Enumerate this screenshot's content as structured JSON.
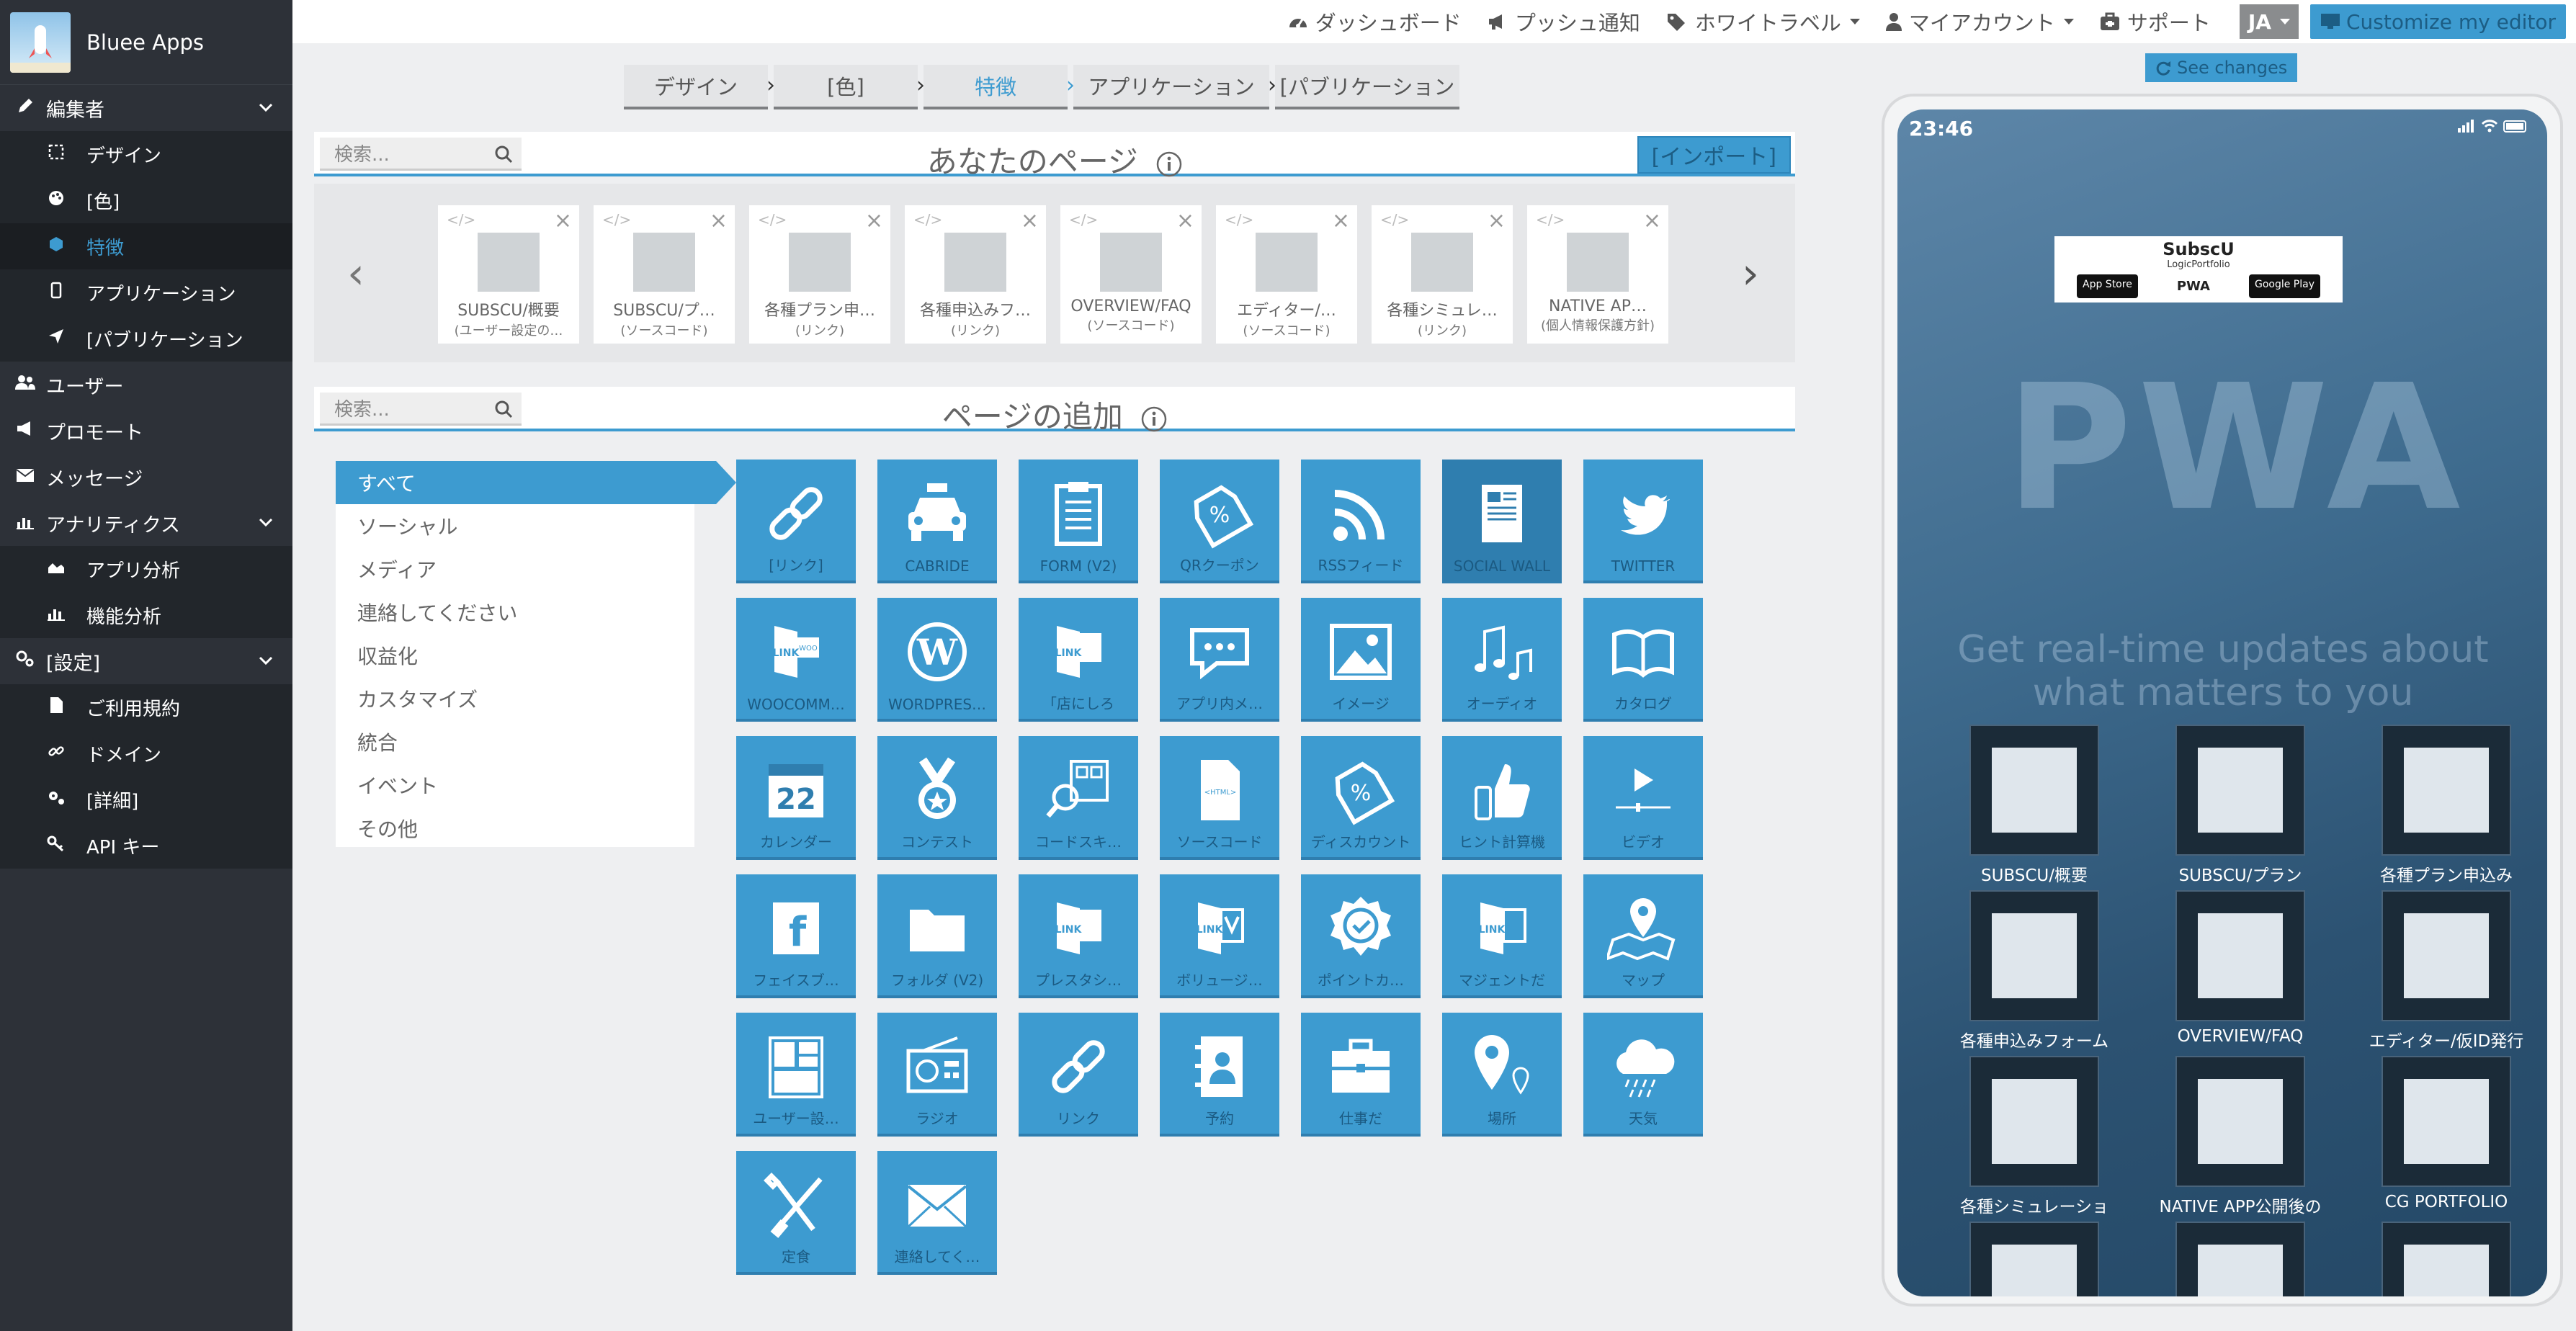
{
  "brand": {
    "name": "Bluee Apps"
  },
  "sidebar": {
    "items": [
      {
        "label": "編集者",
        "icon": "pencil-icon",
        "type": "group"
      },
      {
        "label": "デザイン",
        "icon": "design-icon",
        "type": "sub"
      },
      {
        "label": "[色]",
        "icon": "palette-icon",
        "type": "sub"
      },
      {
        "label": "特徴",
        "icon": "cube-icon",
        "type": "sub",
        "active": true
      },
      {
        "label": "アプリケーション",
        "icon": "mobile-icon",
        "type": "sub"
      },
      {
        "label": "[パブリケーション",
        "icon": "send-icon",
        "type": "sub"
      },
      {
        "label": "ユーザー",
        "icon": "users-icon",
        "type": "top"
      },
      {
        "label": "プロモート",
        "icon": "megaphone-icon",
        "type": "top"
      },
      {
        "label": "メッセージ",
        "icon": "envelope-icon",
        "type": "top"
      },
      {
        "label": "アナリティクス",
        "icon": "bar-chart-icon",
        "type": "group"
      },
      {
        "label": "アプリ分析",
        "icon": "area-chart-icon",
        "type": "sub"
      },
      {
        "label": "機能分析",
        "icon": "bar-chart-icon",
        "type": "sub"
      },
      {
        "label": "[設定]",
        "icon": "settings-icon",
        "type": "group"
      },
      {
        "label": "ご利用規約",
        "icon": "file-icon",
        "type": "sub"
      },
      {
        "label": "ドメイン",
        "icon": "link-icon",
        "type": "sub"
      },
      {
        "label": "[詳細]",
        "icon": "cogs-icon",
        "type": "sub"
      },
      {
        "label": "API キー",
        "icon": "key-icon",
        "type": "sub"
      }
    ]
  },
  "topbar": {
    "dashboard": "ダッシュボード",
    "push": "プッシュ通知",
    "whitelabel": "ホワイトラベル",
    "account": "マイアカウント",
    "support": "サポート",
    "lang": "JA",
    "customize": "Customize my editor"
  },
  "steps": [
    "デザイン",
    "[色]",
    "特徴",
    "アプリケーション",
    "[パブリケーション"
  ],
  "pages_panel": {
    "search_placeholder": "検索...",
    "title": "あなたのページ",
    "import": "[インポート]"
  },
  "pages": [
    {
      "title": "SUBSCU/概要",
      "sub": "(ユーザー設定の…"
    },
    {
      "title": "SUBSCU/プ…",
      "sub": "(ソースコード)"
    },
    {
      "title": "各種プラン申…",
      "sub": "(リンク)"
    },
    {
      "title": "各種申込みフ…",
      "sub": "(リンク)"
    },
    {
      "title": "OVERVIEW/FAQ",
      "sub": "(ソースコード)"
    },
    {
      "title": "エディター/…",
      "sub": "(ソースコード)"
    },
    {
      "title": "各種シミュレ…",
      "sub": "(リンク)"
    },
    {
      "title": "NATIVE AP…",
      "sub": "(個人情報保護方針)"
    }
  ],
  "add_panel": {
    "search_placeholder": "検索...",
    "title": "ページの追加"
  },
  "categories": [
    "すべて",
    "ソーシャル",
    "メディア",
    "連絡してください",
    "収益化",
    "カスタマイズ",
    "統合",
    "イベント",
    "その他"
  ],
  "features": [
    {
      "label": "[リンク]",
      "icon": "link-icon"
    },
    {
      "label": "CABRIDE",
      "icon": "taxi-icon"
    },
    {
      "label": "FORM (V2)",
      "icon": "clipboard-icon"
    },
    {
      "label": "QRクーポン",
      "icon": "coupon-icon"
    },
    {
      "label": "RSSフィード",
      "icon": "rss-icon"
    },
    {
      "label": "SOCIAL WALL",
      "icon": "newspaper-icon",
      "dark": true
    },
    {
      "label": "TWITTER",
      "icon": "twitter-icon"
    },
    {
      "label": "WOOCOMM…",
      "icon": "woo-link-icon"
    },
    {
      "label": "WORDPRES…",
      "icon": "wordpress-icon"
    },
    {
      "label": "「店にしろ",
      "icon": "shopify-link-icon"
    },
    {
      "label": "アプリ内メ…",
      "icon": "chat-icon"
    },
    {
      "label": "イメージ",
      "icon": "image-icon"
    },
    {
      "label": "オーディオ",
      "icon": "music-icon"
    },
    {
      "label": "カタログ",
      "icon": "book-icon"
    },
    {
      "label": "カレンダー",
      "icon": "calendar-icon",
      "text": "22"
    },
    {
      "label": "コンテスト",
      "icon": "medal-icon"
    },
    {
      "label": "コードスキ…",
      "icon": "qr-scan-icon"
    },
    {
      "label": "ソースコード",
      "icon": "html-file-icon",
      "text": "<HTML>"
    },
    {
      "label": "ディスカウント",
      "icon": "discount-icon"
    },
    {
      "label": "ヒント計算機",
      "icon": "thumbs-up-icon"
    },
    {
      "label": "ビデオ",
      "icon": "video-icon"
    },
    {
      "label": "フェイスブ…",
      "icon": "facebook-icon"
    },
    {
      "label": "フォルダ (V2)",
      "icon": "folder-icon"
    },
    {
      "label": "プレスタシ…",
      "icon": "prestashop-link-icon"
    },
    {
      "label": "ボリュージ…",
      "icon": "volusion-link-icon"
    },
    {
      "label": "ポイントカ…",
      "icon": "badge-icon"
    },
    {
      "label": "マジェントだ",
      "icon": "magento-link-icon"
    },
    {
      "label": "マップ",
      "icon": "map-icon"
    },
    {
      "label": "ユーザー設…",
      "icon": "layout-icon"
    },
    {
      "label": "ラジオ",
      "icon": "radio-icon"
    },
    {
      "label": "リンク",
      "icon": "link-icon"
    },
    {
      "label": "予約",
      "icon": "contact-book-icon"
    },
    {
      "label": "仕事だ",
      "icon": "briefcase-icon"
    },
    {
      "label": "場所",
      "icon": "location-icon"
    },
    {
      "label": "天気",
      "icon": "weather-icon"
    },
    {
      "label": "定食",
      "icon": "utensils-icon"
    },
    {
      "label": "連絡してく…",
      "icon": "envelope-icon"
    }
  ],
  "preview": {
    "see_changes": "See changes",
    "time": "23:46",
    "banner_title": "SubscU",
    "banner_sub": "LogicPortfolio",
    "store1": "App Store",
    "store2": "PWA",
    "store3": "Google Play",
    "bg_logo": "PWA",
    "tagline": "Get real-time updates about what matters to you",
    "apps": [
      {
        "label": "SUBSCU/概要"
      },
      {
        "label": "SUBSCU/プラン"
      },
      {
        "label": "各種プラン申込み"
      },
      {
        "label": "各種申込みフォーム"
      },
      {
        "label": "OVERVIEW/FAQ"
      },
      {
        "label": "エディター/仮ID発行"
      },
      {
        "label": "各種シミュレーショ"
      },
      {
        "label": "NATIVE APP公開後の"
      },
      {
        "label": "CG PORTFOLIO"
      },
      {
        "label": ""
      },
      {
        "label": ""
      },
      {
        "label": ""
      }
    ]
  },
  "colors": {
    "accent": "#3d9bd0",
    "sidebar": "#2d3138",
    "tile_label": "#1b5a82"
  }
}
